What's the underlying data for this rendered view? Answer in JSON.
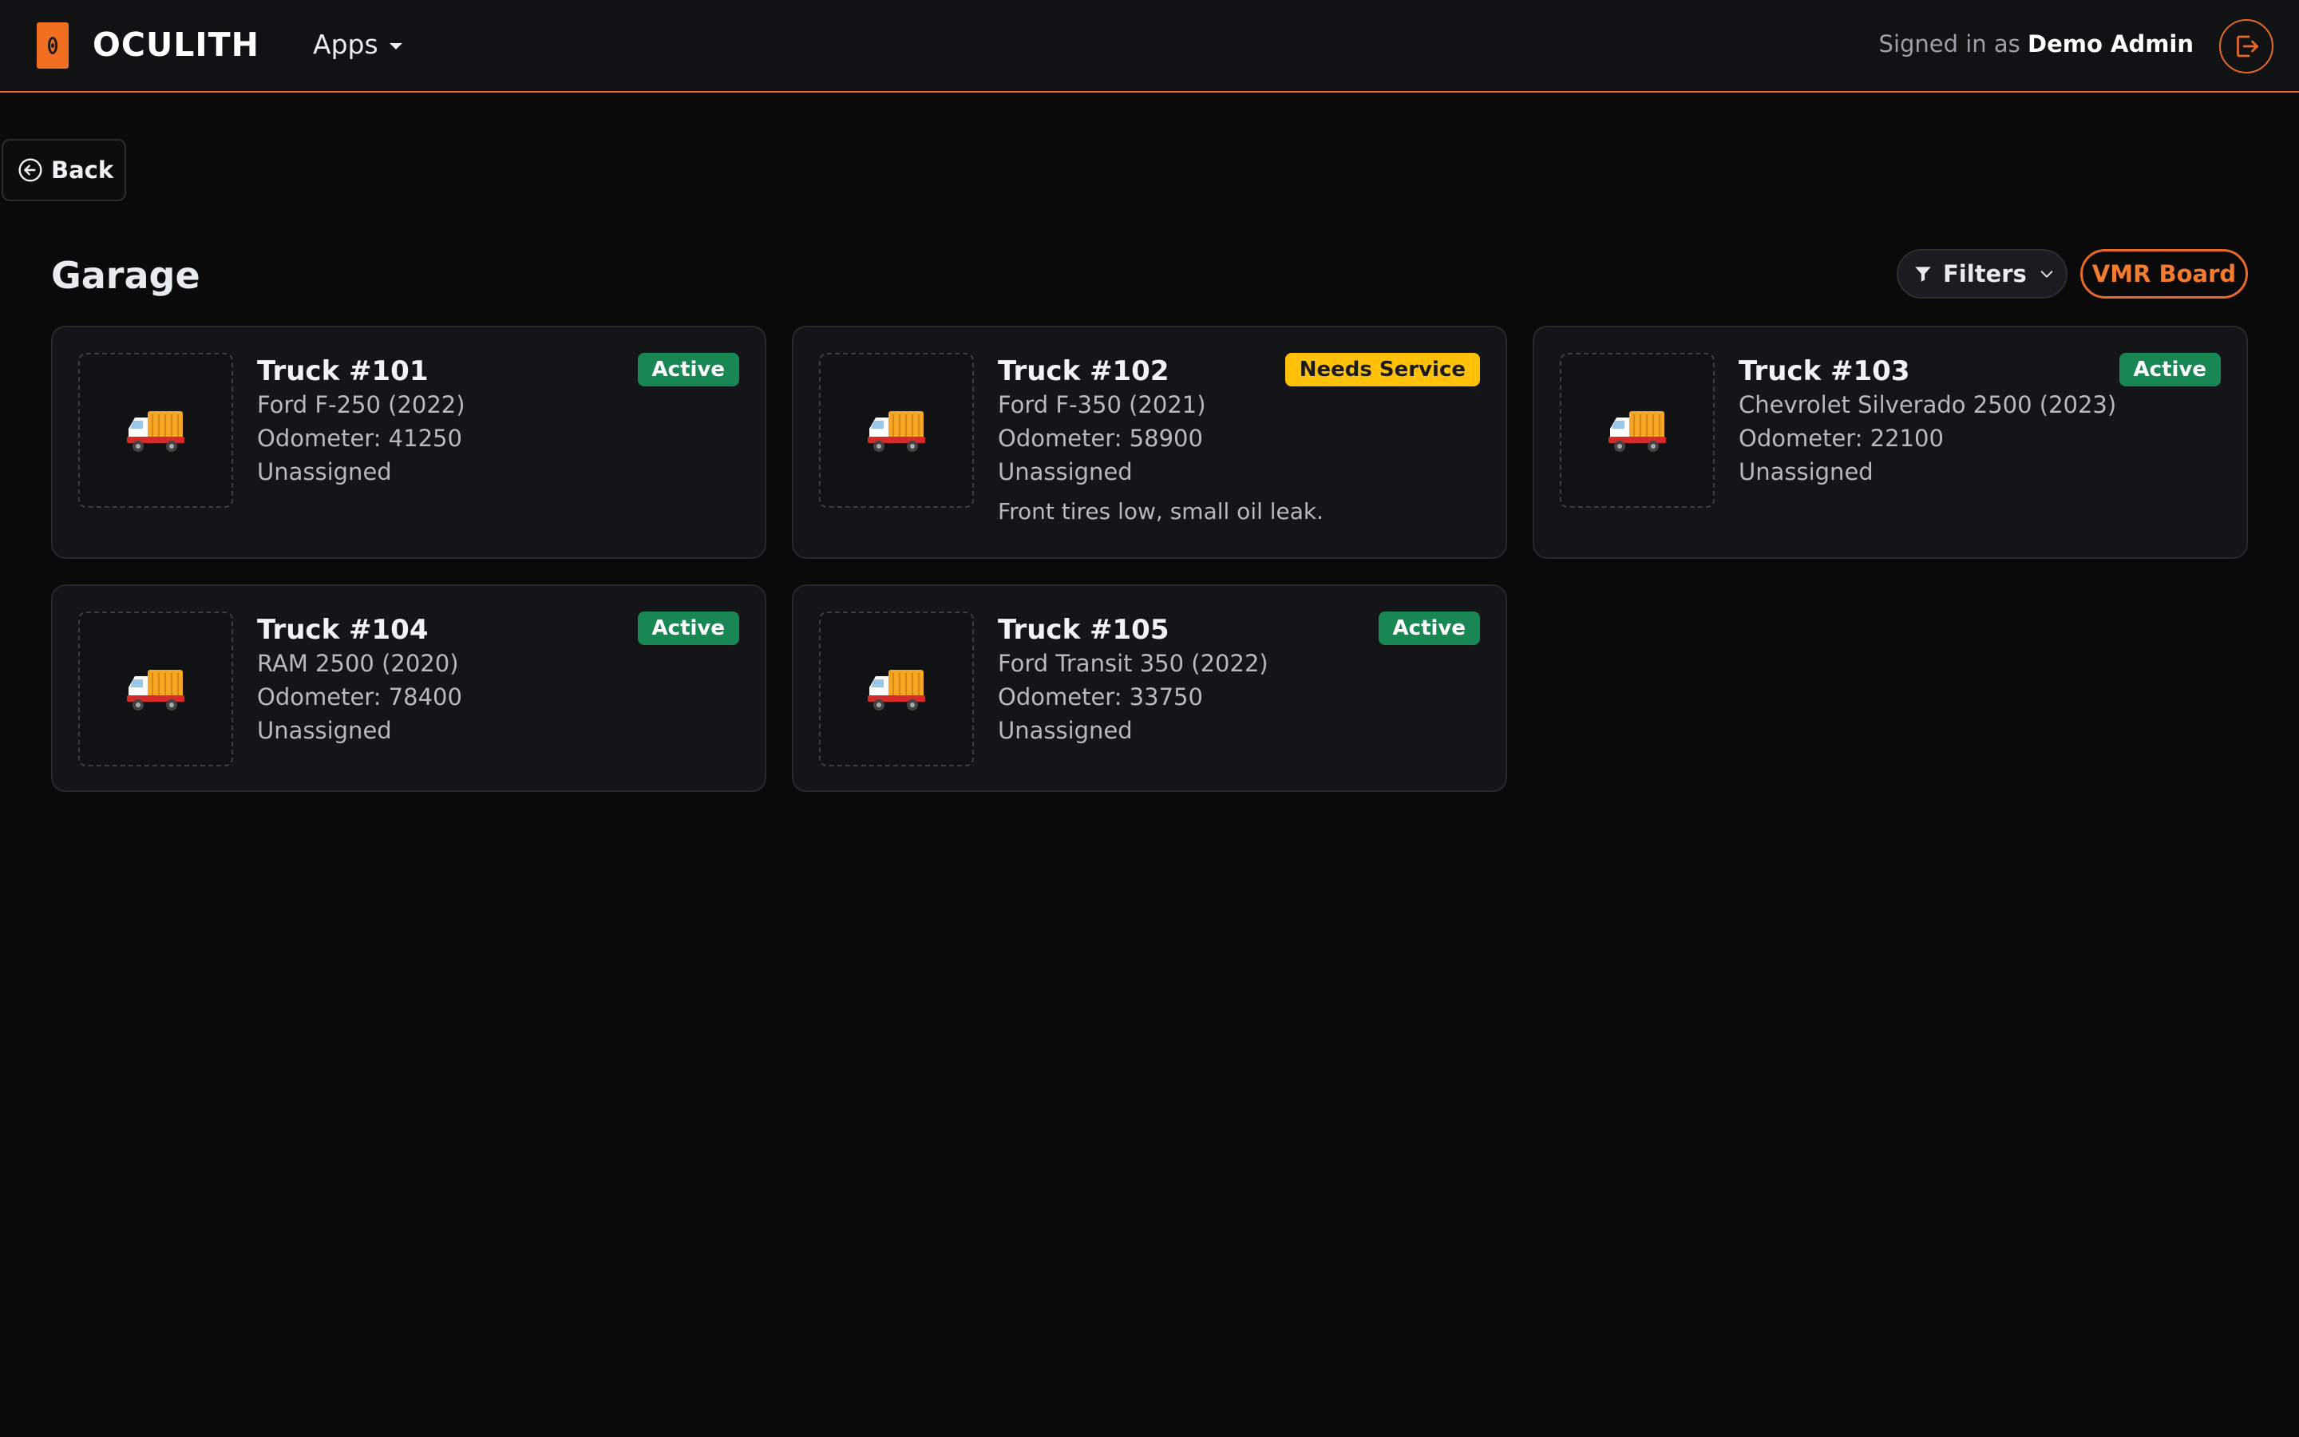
{
  "app": {
    "brand": "OCULITH",
    "apps_menu_label": "Apps",
    "signed_in_prefix": "Signed in as",
    "user_name": "Demo Admin",
    "accent_color": "#e8692a"
  },
  "nav": {
    "back_label": "Back"
  },
  "page": {
    "title": "Garage",
    "filters_label": "Filters",
    "vmr_board_label": "VMR Board"
  },
  "trucks": [
    {
      "name": "Truck #101",
      "model": "Ford F-250 (2022)",
      "odometer": "Odometer: 41250",
      "assignment": "Unassigned",
      "status": "Active",
      "note": ""
    },
    {
      "name": "Truck #102",
      "model": "Ford F-350 (2021)",
      "odometer": "Odometer: 58900",
      "assignment": "Unassigned",
      "status": "Needs Service",
      "note": "Front tires low, small oil leak."
    },
    {
      "name": "Truck #103",
      "model": "Chevrolet Silverado 2500 (2023)",
      "odometer": "Odometer: 22100",
      "assignment": "Unassigned",
      "status": "Active",
      "note": ""
    },
    {
      "name": "Truck #104",
      "model": "RAM 2500 (2020)",
      "odometer": "Odometer: 78400",
      "assignment": "Unassigned",
      "status": "Active",
      "note": ""
    },
    {
      "name": "Truck #105",
      "model": "Ford Transit 350 (2022)",
      "odometer": "Odometer: 33750",
      "assignment": "Unassigned",
      "status": "Active",
      "note": ""
    }
  ],
  "icons": {
    "logo": "oculith-logo-icon",
    "apps": "chevron-down-icon",
    "logout": "logout-icon",
    "back": "arrow-left-circle-icon",
    "filters": "funnel-icon",
    "truck": "delivery-truck-icon"
  },
  "status_colors": {
    "Active": "#198754",
    "Needs Service": "#ffc107"
  }
}
